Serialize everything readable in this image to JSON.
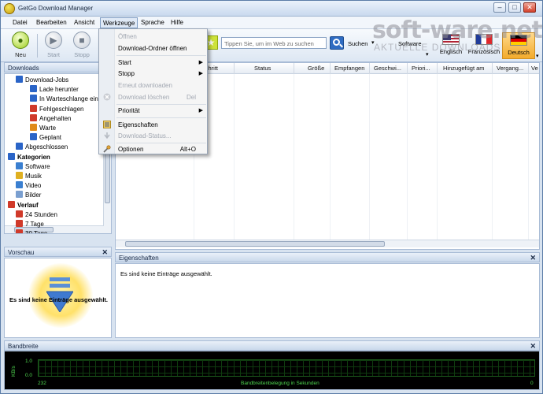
{
  "window": {
    "title": "GetGo Download Manager"
  },
  "menubar": [
    "Datei",
    "Bearbeiten",
    "Ansicht",
    "Werkzeuge",
    "Sprache",
    "Hilfe"
  ],
  "toolbar": {
    "buttons": [
      {
        "label": "Neu",
        "enabled": true
      },
      {
        "label": "Start",
        "enabled": false
      },
      {
        "label": "Stopp",
        "enabled": false
      }
    ],
    "search_placeholder": "Tippen Sie, um im Web zu suchen",
    "search_label": "Suchen",
    "category": "Software",
    "languages": [
      {
        "label": "Englisch",
        "active": false
      },
      {
        "label": "Französisch",
        "active": false
      },
      {
        "label": "Deutsch",
        "active": true
      }
    ]
  },
  "dropdown": {
    "items": [
      {
        "label": "Öffnen",
        "enabled": false
      },
      {
        "label": "Download-Ordner öffnen",
        "enabled": true
      },
      {
        "label": "Start",
        "enabled": true,
        "submenu": true
      },
      {
        "label": "Stopp",
        "enabled": true,
        "submenu": true
      },
      {
        "label": "Erneut downloaden",
        "enabled": false
      },
      {
        "label": "Download löschen",
        "enabled": false,
        "shortcut": "Del"
      },
      {
        "label": "Priorität",
        "enabled": true,
        "submenu": true
      },
      {
        "label": "Eigenschaften",
        "enabled": true
      },
      {
        "label": "Download-Status...",
        "enabled": false
      },
      {
        "label": "Optionen",
        "enabled": true,
        "shortcut": "Alt+O"
      }
    ]
  },
  "downloads_panel": {
    "title": "Downloads",
    "tree": [
      {
        "label": "Download-Jobs",
        "level": 1,
        "bold": false,
        "color": "#2a64c7"
      },
      {
        "label": "Lade herunter",
        "level": 2,
        "bold": false,
        "color": "#2a64c7"
      },
      {
        "label": "In Warteschlange ein",
        "level": 2,
        "bold": false,
        "color": "#2a64c7"
      },
      {
        "label": "Fehlgeschlagen",
        "level": 2,
        "bold": false,
        "color": "#d03a2a"
      },
      {
        "label": "Angehalten",
        "level": 2,
        "bold": false,
        "color": "#d03a2a"
      },
      {
        "label": "Warte",
        "level": 2,
        "bold": false,
        "color": "#e08a1a"
      },
      {
        "label": "Geplant",
        "level": 2,
        "bold": false,
        "color": "#2a64c7"
      },
      {
        "label": "Abgeschlossen",
        "level": 1,
        "bold": false,
        "color": "#2a64c7"
      },
      {
        "label": "Kategorien",
        "level": 0,
        "bold": true,
        "color": "#2a64c7"
      },
      {
        "label": "Software",
        "level": 1,
        "bold": false,
        "color": "#3a7fd0"
      },
      {
        "label": "Musik",
        "level": 1,
        "bold": false,
        "color": "#e0b020"
      },
      {
        "label": "Video",
        "level": 1,
        "bold": false,
        "color": "#3a7fd0"
      },
      {
        "label": "Bilder",
        "level": 1,
        "bold": false,
        "color": "#7a9fd0"
      },
      {
        "label": "Verlauf",
        "level": 0,
        "bold": true,
        "color": "#d03a2a"
      },
      {
        "label": "24 Stunden",
        "level": 1,
        "bold": false,
        "color": "#d03a2a"
      },
      {
        "label": "7 Tage",
        "level": 1,
        "bold": false,
        "color": "#d03a2a"
      },
      {
        "label": "30 Tage",
        "level": 1,
        "bold": false,
        "color": "#d03a2a"
      }
    ]
  },
  "list": {
    "columns": [
      "schritt",
      "Status",
      "Größe",
      "Empfangen",
      "Geschwi...",
      "Priori...",
      "Hinzugefügt am",
      "Vergang...",
      "Ve"
    ]
  },
  "preview": {
    "title": "Vorschau",
    "empty_text": "Es sind keine Einträge ausgewählt."
  },
  "properties": {
    "title": "Eigenschaften",
    "empty_text": "Es sind keine Einträge ausgewählt."
  },
  "bandwidth": {
    "title": "Bandbreite",
    "unit": "KB/s",
    "y_max": "1.0",
    "y_min": "0.0",
    "x_left": "232",
    "x_label": "Bandbreitenbelegung in Sekunden",
    "x_right": "0"
  },
  "watermark": {
    "title": "soft-ware.net",
    "subtitle": "AKTUELLE DOWNLOADS"
  }
}
